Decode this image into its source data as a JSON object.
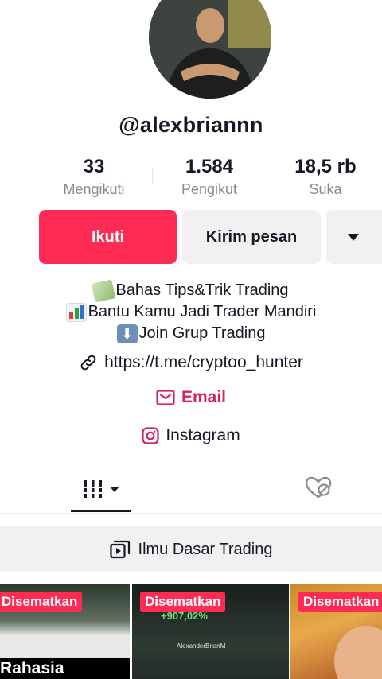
{
  "profile": {
    "username": "@alexbriannn",
    "avatar_icon": "profile-avatar"
  },
  "stats": [
    {
      "value": "33",
      "label": "Mengikuti"
    },
    {
      "value": "1.584",
      "label": "Pengikut"
    },
    {
      "value": "18,5 rb",
      "label": "Suka"
    }
  ],
  "actions": {
    "follow_label": "Ikuti",
    "message_label": "Kirim pesan",
    "more_icon": "triangle-down-icon"
  },
  "bio": {
    "lines": [
      {
        "icon": "money-emoji",
        "text": "Bahas Tips&Trik Trading"
      },
      {
        "icon": "bar-chart-emoji",
        "text": "Bantu Kamu Jadi Trader Mandiri"
      },
      {
        "icon": "down-arrow-emoji",
        "text": "Join Grup Trading"
      }
    ],
    "link_text": "https://t.me/cryptoo_hunter",
    "email_label": "Email",
    "instagram_label": "Instagram"
  },
  "tabs": {
    "videos_icon": "grid-icon",
    "liked_icon": "hidden-heart-icon"
  },
  "playlist": {
    "label": "Ilmu Dasar Trading",
    "icon": "playlist-icon"
  },
  "videos": [
    {
      "pinned_label": "Disematkan",
      "caption": "Rahasia Trading"
    },
    {
      "pinned_label": "Disematkan",
      "profit": "+907,02%",
      "name": "AlexanderBrianM"
    },
    {
      "pinned_label": "Disematkan"
    }
  ],
  "colors": {
    "accent": "#fe2c55",
    "email": "#d6225e",
    "secondary_bg": "#f1f1f2",
    "muted_text": "#8a8b91"
  }
}
